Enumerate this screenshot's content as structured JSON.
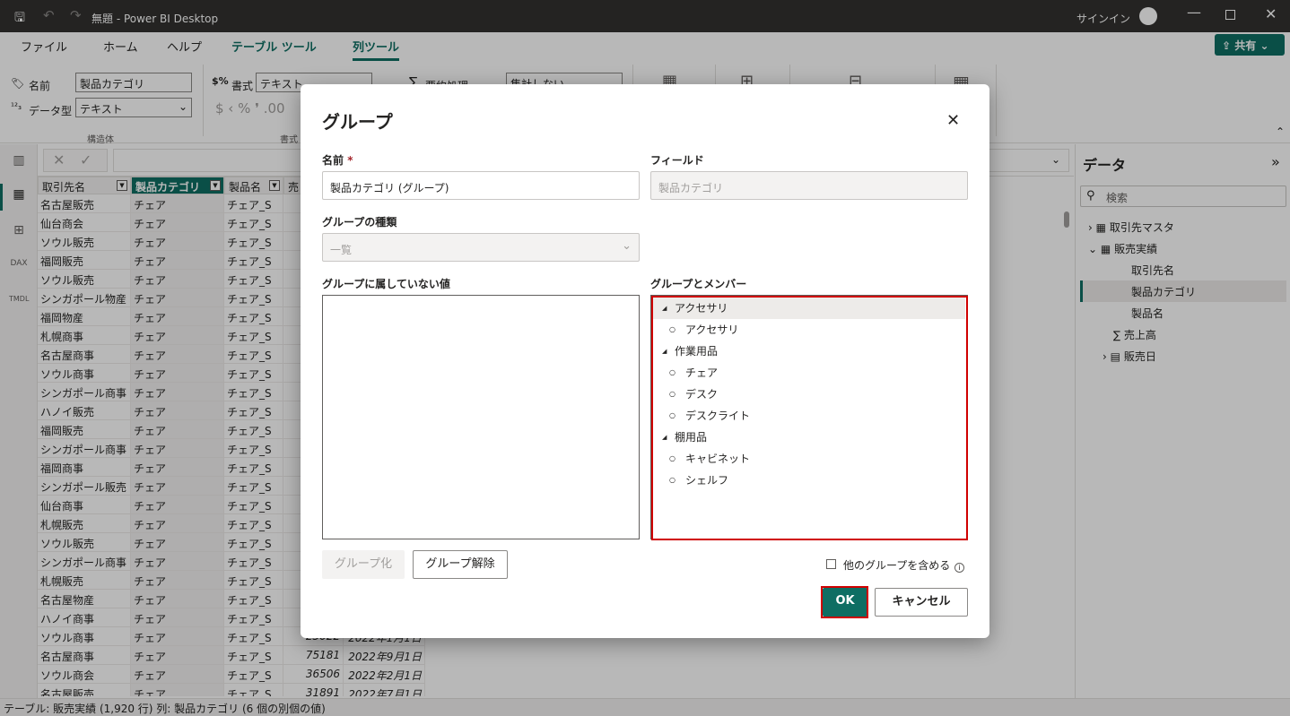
{
  "window": {
    "title": "無題 - Power BI Desktop",
    "signin": "サインイン"
  },
  "ribbon_tabs": [
    "ファイル",
    "ホーム",
    "ヘルプ",
    "テーブル ツール",
    "列ツール"
  ],
  "share_label": "共有",
  "ribbon": {
    "name_label": "名前",
    "name_value": "製品カテゴリ",
    "datatype_label": "データ型",
    "datatype_value": "テキスト",
    "structure_group": "構造体",
    "format_label": "書式",
    "format_value": "テキスト",
    "format_group": "書式",
    "summarize_label": "要約処理",
    "summarize_value": "集計しない",
    "currency_symbols": "$ ‹ % ❜ .00"
  },
  "grid": {
    "headers": [
      "取引先名",
      "製品カテゴリ",
      "製品名",
      "売"
    ],
    "rows": [
      [
        "名古屋販売",
        "チェア",
        "チェア_S"
      ],
      [
        "仙台商会",
        "チェア",
        "チェア_S"
      ],
      [
        "ソウル販売",
        "チェア",
        "チェア_S"
      ],
      [
        "福岡販売",
        "チェア",
        "チェア_S"
      ],
      [
        "ソウル販売",
        "チェア",
        "チェア_S"
      ],
      [
        "シンガポール物産",
        "チェア",
        "チェア_S"
      ],
      [
        "福岡物産",
        "チェア",
        "チェア_S"
      ],
      [
        "札幌商事",
        "チェア",
        "チェア_S"
      ],
      [
        "名古屋商事",
        "チェア",
        "チェア_S"
      ],
      [
        "ソウル商事",
        "チェア",
        "チェア_S"
      ],
      [
        "シンガポール商事",
        "チェア",
        "チェア_S"
      ],
      [
        "ハノイ販売",
        "チェア",
        "チェア_S"
      ],
      [
        "福岡販売",
        "チェア",
        "チェア_S"
      ],
      [
        "シンガポール商事",
        "チェア",
        "チェア_S"
      ],
      [
        "福岡商事",
        "チェア",
        "チェア_S"
      ],
      [
        "シンガポール販売",
        "チェア",
        "チェア_S"
      ],
      [
        "仙台商事",
        "チェア",
        "チェア_S"
      ],
      [
        "札幌販売",
        "チェア",
        "チェア_S"
      ],
      [
        "ソウル販売",
        "チェア",
        "チェア_S"
      ],
      [
        "シンガポール商事",
        "チェア",
        "チェア_S"
      ],
      [
        "札幌販売",
        "チェア",
        "チェア_S"
      ],
      [
        "名古屋物産",
        "チェア",
        "チェア_S"
      ],
      [
        "ハノイ商事",
        "チェア",
        "チェア_S"
      ],
      [
        "ソウル商事",
        "チェア",
        "チェア_S",
        "23022",
        "2022年1月1日"
      ],
      [
        "名古屋商事",
        "チェア",
        "チェア_S",
        "75181",
        "2022年9月1日"
      ],
      [
        "ソウル商会",
        "チェア",
        "チェア_S",
        "36506",
        "2022年2月1日"
      ],
      [
        "名古屋販売",
        "チェア",
        "チェア_S",
        "31891",
        "2022年7月1日"
      ]
    ]
  },
  "data_pane": {
    "title": "データ",
    "search_placeholder": "検索",
    "items": [
      "取引先マスタ",
      "販売実績",
      "取引先名",
      "製品カテゴリ",
      "製品名",
      "売上高",
      "販売日"
    ]
  },
  "status": "テーブル: 販売実績 (1,920 行) 列: 製品カテゴリ (6 個の別個の値)",
  "dialog": {
    "title": "グループ",
    "name_label": "名前",
    "required": "*",
    "name_value": "製品カテゴリ (グループ)",
    "field_label": "フィールド",
    "field_value": "製品カテゴリ",
    "type_label": "グループの種類",
    "type_value": "一覧",
    "ungrouped_label": "グループに属していない値",
    "groups_label": "グループとメンバー",
    "groups": [
      {
        "name": "アクセサリ",
        "members": [
          "アクセサリ"
        ]
      },
      {
        "name": "作業用品",
        "members": [
          "チェア",
          "デスク",
          "デスクライト"
        ]
      },
      {
        "name": "棚用品",
        "members": [
          "キャビネット",
          "シェルフ"
        ]
      }
    ],
    "group_btn": "グループ化",
    "ungroup_btn": "グループ解除",
    "include_other": "他のグループを含める",
    "ok": "OK",
    "cancel": "キャンセル"
  }
}
